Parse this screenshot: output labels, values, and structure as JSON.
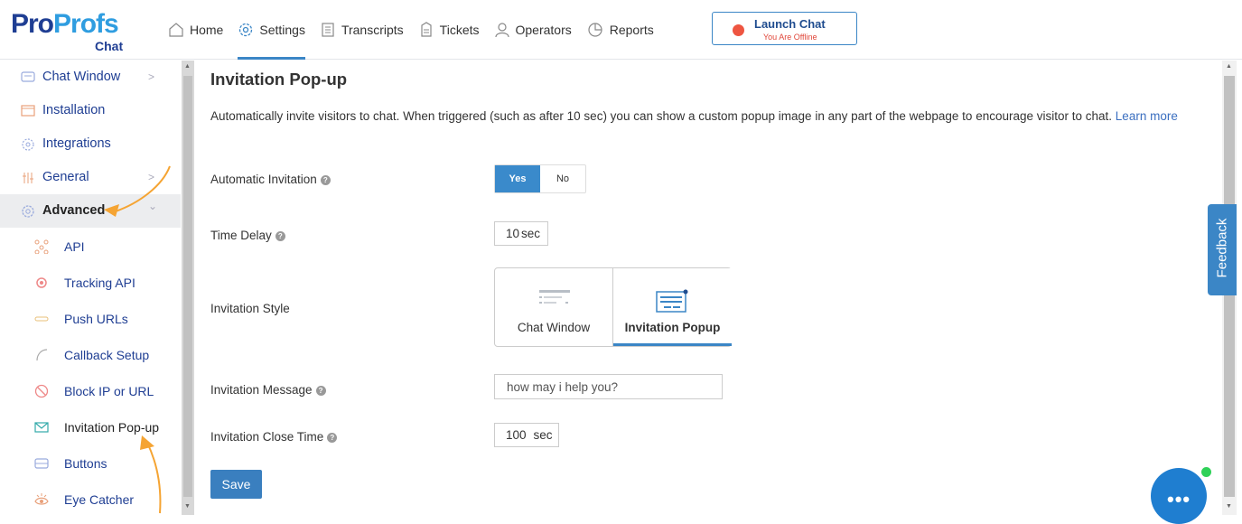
{
  "brand": {
    "logo_part1": "Pro",
    "logo_part2": "Profs",
    "logo_sub": "Chat"
  },
  "nav": {
    "items": [
      {
        "label": "Home",
        "icon": "home-icon"
      },
      {
        "label": "Settings",
        "icon": "gear-icon",
        "active": true
      },
      {
        "label": "Transcripts",
        "icon": "document-icon"
      },
      {
        "label": "Tickets",
        "icon": "ticket-icon"
      },
      {
        "label": "Operators",
        "icon": "user-icon"
      },
      {
        "label": "Reports",
        "icon": "pie-chart-icon"
      }
    ],
    "launch_label": "Launch Chat",
    "launch_status": "You Are Offline",
    "colors": {
      "accent": "#3b86c6",
      "offline": "#ee5541"
    }
  },
  "sidebar": {
    "items": [
      {
        "label": "Chat Window",
        "icon": "chat-window-icon",
        "chevron": ">"
      },
      {
        "label": "Installation",
        "icon": "installation-icon"
      },
      {
        "label": "Integrations",
        "icon": "integrations-icon"
      },
      {
        "label": "General",
        "icon": "sliders-icon",
        "chevron": ">"
      },
      {
        "label": "Advanced",
        "icon": "gear-icon",
        "chevron": "⌄",
        "active": true
      }
    ],
    "sub_items": [
      {
        "label": "API",
        "icon": "api-icon"
      },
      {
        "label": "Tracking API",
        "icon": "tracking-icon"
      },
      {
        "label": "Push URLs",
        "icon": "push-url-icon"
      },
      {
        "label": "Callback Setup",
        "icon": "phone-icon"
      },
      {
        "label": "Block IP or URL",
        "icon": "block-icon"
      },
      {
        "label": "Invitation Pop-up",
        "icon": "envelope-icon",
        "current": true
      },
      {
        "label": "Buttons",
        "icon": "buttons-icon"
      },
      {
        "label": "Eye Catcher",
        "icon": "eye-icon"
      }
    ]
  },
  "main": {
    "title": "Invitation Pop-up",
    "description": "Automatically invite visitors to chat. When triggered (such as after 10 sec) you can show a custom popup image in any part of the webpage to encourage visitor to chat.",
    "learn_more": "Learn more",
    "auto_invite": {
      "label": "Automatic Invitation",
      "yes": "Yes",
      "no": "No",
      "selected": "Yes"
    },
    "time_delay": {
      "label": "Time Delay",
      "value": "10",
      "unit": "sec"
    },
    "invitation_style": {
      "label": "Invitation Style",
      "options": [
        "Chat Window",
        "Invitation Popup"
      ],
      "selected": "Invitation Popup"
    },
    "invitation_message": {
      "label": "Invitation Message",
      "value": "how may i help you?"
    },
    "close_time": {
      "label": "Invitation Close Time",
      "value": "100",
      "unit": "sec"
    },
    "save_label": "Save"
  },
  "feedback_label": "Feedback"
}
